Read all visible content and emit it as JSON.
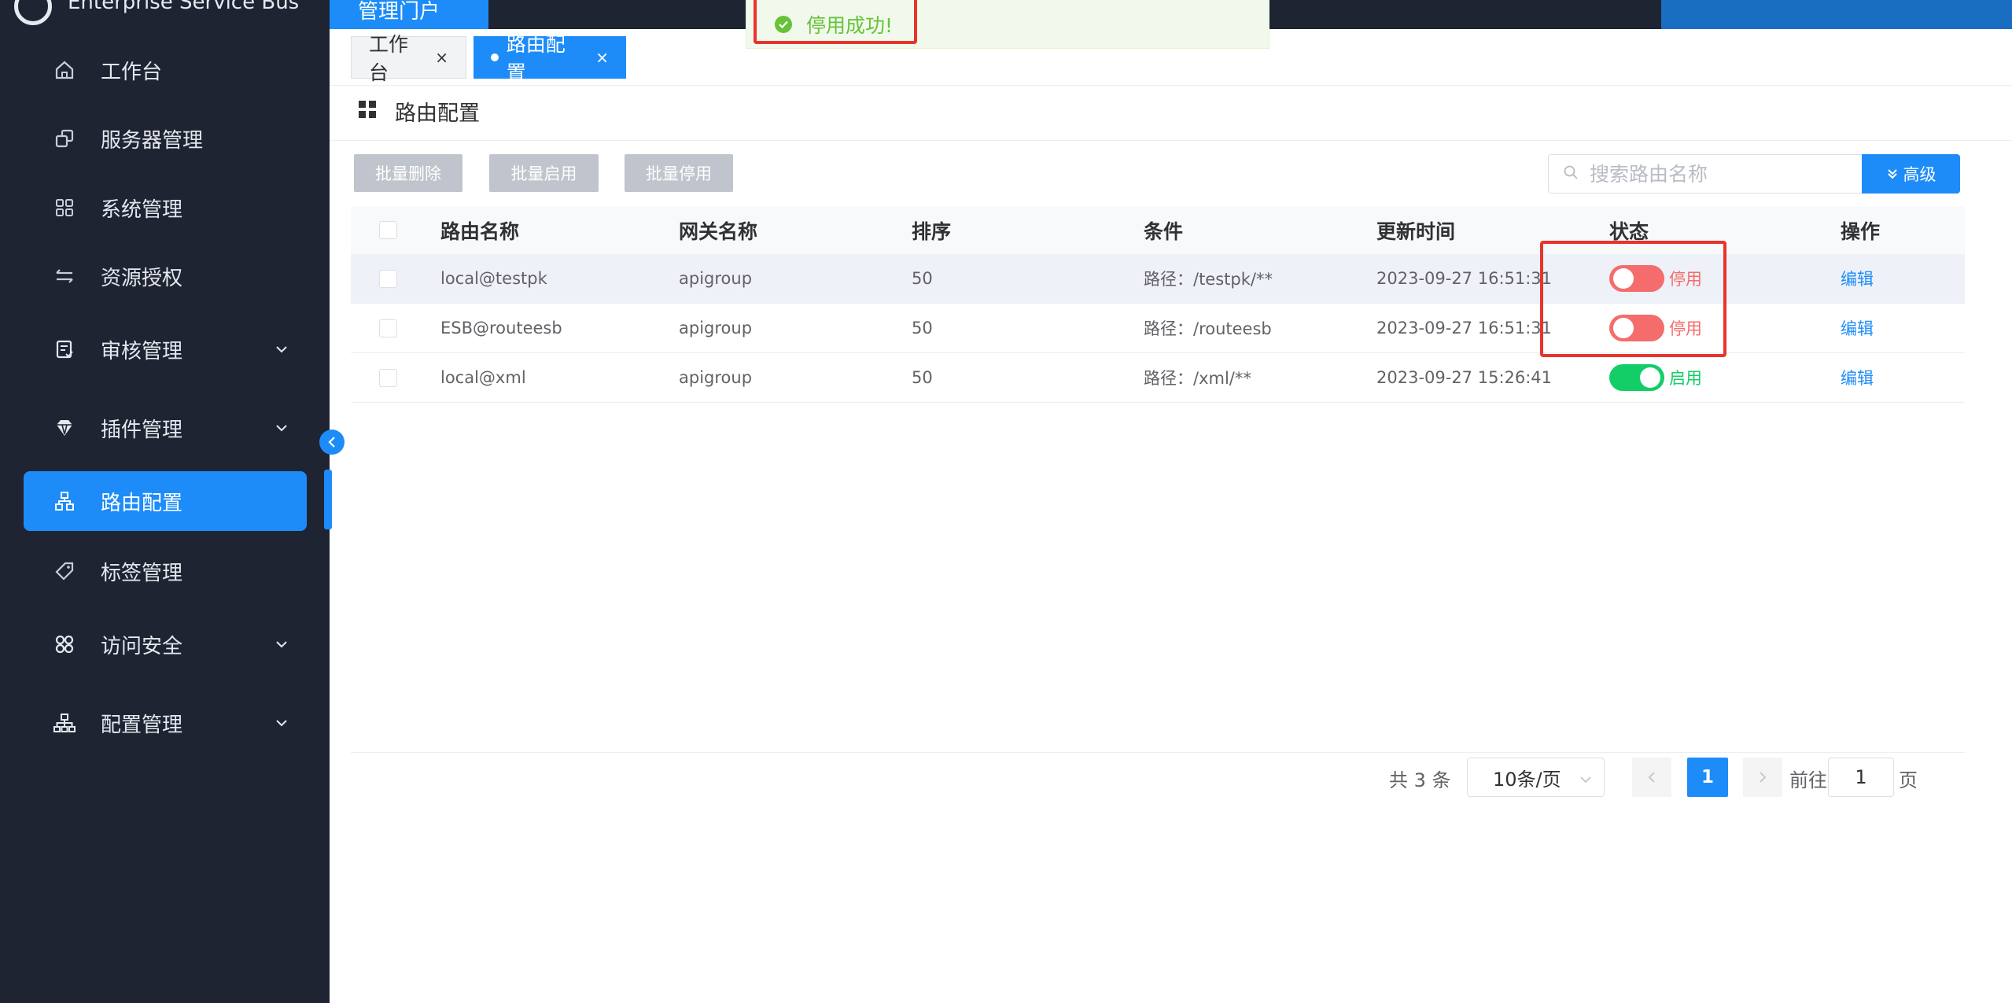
{
  "brand": {
    "title": "Enterprise Service Bus"
  },
  "sidebar": {
    "items": [
      {
        "label": "工作台",
        "icon": "home-icon"
      },
      {
        "label": "服务器管理",
        "icon": "server-icon"
      },
      {
        "label": "系统管理",
        "icon": "grid-icon"
      },
      {
        "label": "资源授权",
        "icon": "transfer-icon"
      },
      {
        "label": "审核管理",
        "icon": "audit-icon"
      },
      {
        "label": "插件管理",
        "icon": "diamond-icon"
      },
      {
        "label": "路由配置",
        "icon": "route-icon"
      },
      {
        "label": "标签管理",
        "icon": "tag-icon"
      },
      {
        "label": "访问安全",
        "icon": "security-icon"
      },
      {
        "label": "配置管理",
        "icon": "config-icon"
      }
    ]
  },
  "topbar": {
    "active_tab": "管理门户"
  },
  "toast": {
    "message": "停用成功!"
  },
  "tabs": {
    "tab1": "工作台",
    "tab2": "路由配置",
    "close": "×"
  },
  "page": {
    "title": "路由配置"
  },
  "toolbar": {
    "batch_delete": "批量删除",
    "batch_enable": "批量启用",
    "batch_disable": "批量停用",
    "search_placeholder": "搜索路由名称",
    "advanced": "高级"
  },
  "table": {
    "headers": [
      "路由名称",
      "网关名称",
      "排序",
      "条件",
      "更新时间",
      "状态",
      "操作"
    ],
    "rows": [
      {
        "name": "local@testpk",
        "gateway": "apigroup",
        "sort": "50",
        "condition": "路径：/testpk/**",
        "time": "2023-09-27 16:51:31",
        "status": "停用",
        "enabled": false,
        "op": "编辑"
      },
      {
        "name": "ESB@routeesb",
        "gateway": "apigroup",
        "sort": "50",
        "condition": "路径：/routeesb",
        "time": "2023-09-27 16:51:31",
        "status": "停用",
        "enabled": false,
        "op": "编辑"
      },
      {
        "name": "local@xml",
        "gateway": "apigroup",
        "sort": "50",
        "condition": "路径：/xml/**",
        "time": "2023-09-27 15:26:41",
        "status": "启用",
        "enabled": true,
        "op": "编辑"
      }
    ]
  },
  "pagination": {
    "total": "共 3 条",
    "page_size": "10条/页",
    "current": "1",
    "goto_label": "前往",
    "goto_value": "1",
    "page_suffix": "页"
  },
  "colors": {
    "primary": "#1d8cf8",
    "sidebar_bg": "#1f2433",
    "danger": "#f56c6c",
    "success": "#13ce66",
    "highlight": "#e8342c"
  }
}
